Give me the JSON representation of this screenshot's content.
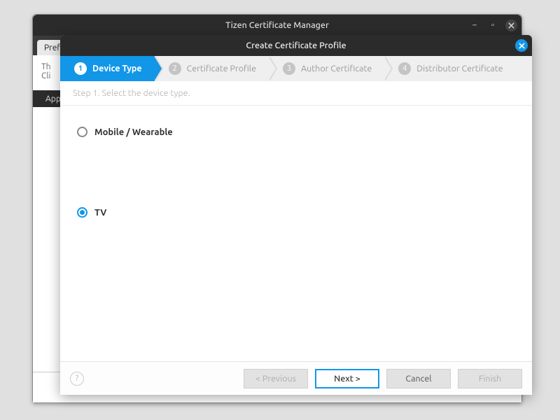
{
  "bg_window": {
    "title": "Tizen Certificate Manager",
    "tab_prefs": "Prefe",
    "hint_line1": "Th",
    "hint_line2": "Cli",
    "subtab": "App"
  },
  "modal": {
    "title": "Create Certificate Profile"
  },
  "wizard": {
    "steps": [
      {
        "num": "1",
        "label": "Device Type"
      },
      {
        "num": "2",
        "label": "Certificate Profile"
      },
      {
        "num": "3",
        "label": "Author Certificate"
      },
      {
        "num": "4",
        "label": "Distributor Certificate"
      }
    ],
    "description": "Step 1. Select the device type."
  },
  "options": {
    "mobile": "Mobile / Wearable",
    "tv": "TV",
    "selected": "tv"
  },
  "buttons": {
    "previous": "< Previous",
    "next": "Next >",
    "cancel": "Cancel",
    "finish": "Finish"
  }
}
